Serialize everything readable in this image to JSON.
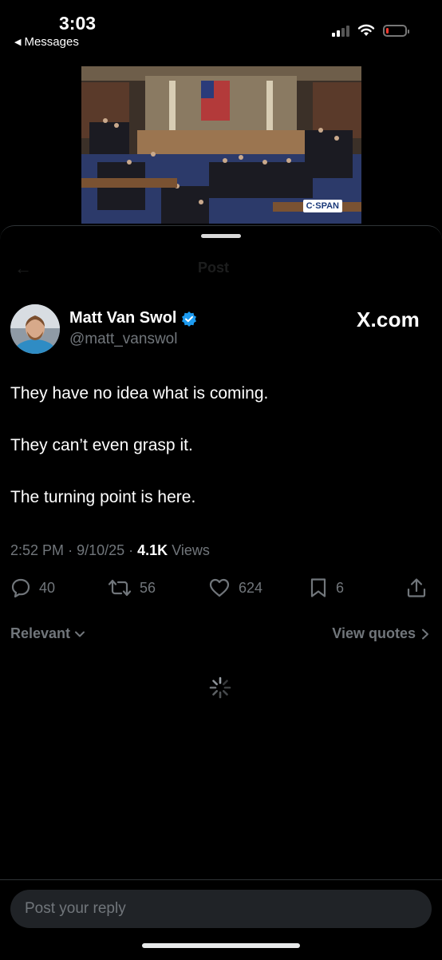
{
  "status_bar": {
    "time": "3:03",
    "back_app": "Messages",
    "battery_color": "#ff3b30",
    "battery_level": 0.15
  },
  "video": {
    "source_badge": "C·SPAN"
  },
  "header": {
    "title": "Post"
  },
  "post": {
    "author_name": "Matt Van Swol",
    "author_handle": "@matt_vanswol",
    "verified_color": "#1d9bf0",
    "site_label": "X.com",
    "lines": [
      "They have no idea what is coming.",
      "They can’t even grasp it.",
      "The turning point is here."
    ],
    "time": "2:52 PM",
    "date": "9/10/25",
    "views_count": "4.1K",
    "views_label": "Views"
  },
  "actions": {
    "replies": "40",
    "reposts": "56",
    "likes": "624",
    "bookmarks": "6"
  },
  "filters": {
    "sort_label": "Relevant",
    "quotes_label": "View quotes"
  },
  "reply": {
    "placeholder": "Post your reply"
  },
  "icons": {
    "back": "back-arrow-icon",
    "verified": "verified-badge-icon",
    "reply": "reply-icon",
    "repost": "repost-icon",
    "like": "heart-icon",
    "bookmark": "bookmark-icon",
    "share": "share-icon",
    "loading": "loading-spinner-icon"
  }
}
